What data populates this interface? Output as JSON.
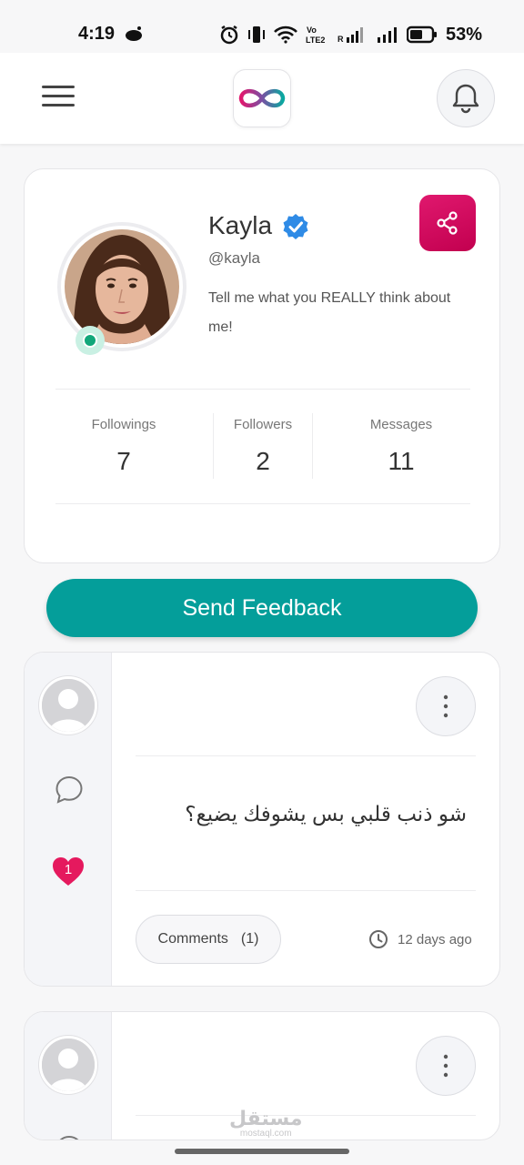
{
  "status_bar": {
    "time": "4:19",
    "battery": "53%",
    "icons": [
      "alarm-icon",
      "vibrate-icon",
      "wifi-icon",
      "volte-icon",
      "signal-icon",
      "battery-icon"
    ]
  },
  "header": {
    "menu_icon": "hamburger-icon",
    "logo": "infinity-logo",
    "notifications_icon": "bell-icon"
  },
  "profile": {
    "name": "Kayla",
    "handle": "@kayla",
    "bio": "Tell me what you REALLY think about me!",
    "verified": true,
    "online": true,
    "stats": [
      {
        "label": "Followings",
        "value": "7"
      },
      {
        "label": "Followers",
        "value": "2"
      },
      {
        "label": "Messages",
        "value": "11"
      }
    ]
  },
  "actions": {
    "send_feedback": "Send Feedback"
  },
  "posts": [
    {
      "text": "شو ذنب قلبي بس يشوفك يضيع؟",
      "likes": "1",
      "comments_label": "Comments",
      "comments_count": "(1)",
      "time": "12 days ago"
    }
  ],
  "watermark": {
    "ar": "مستقل",
    "en": "mostaql.com"
  },
  "colors": {
    "accent_teal": "#049e9a",
    "share_pink": "#d40a62",
    "heart_pink": "#e5195e",
    "verified_blue": "#2f8be6",
    "online_green": "#11a77a"
  }
}
